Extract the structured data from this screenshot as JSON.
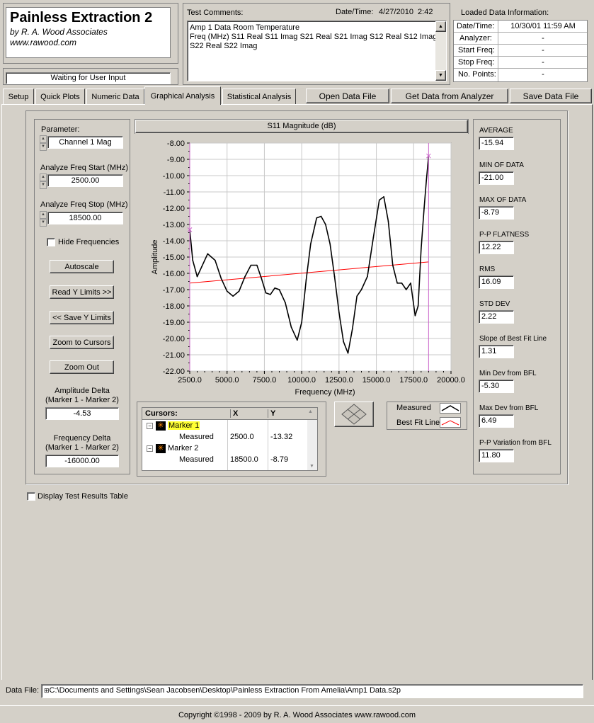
{
  "app": {
    "title": "Painless Extraction 2",
    "byline": "by R. A. Wood Associates",
    "website": "www.rawood.com",
    "status": "Waiting for User Input"
  },
  "comments": {
    "label": "Test Comments:",
    "datetime_label": "Date/Time:",
    "datetime_value": "4/27/2010  2:42",
    "lines": [
      "Amp 1 Data Room Temperature",
      "Freq (MHz) S11 Real S11 Imag S21 Real S21 Imag S12 Real S12 Imag",
      "S22 Real S22 Imag"
    ]
  },
  "loaded": {
    "header": "Loaded Data Information:",
    "rows": [
      {
        "label": "Date/Time:",
        "value": "10/30/01 11:59 AM"
      },
      {
        "label": "Analyzer:",
        "value": "-"
      },
      {
        "label": "Start Freq:",
        "value": "-"
      },
      {
        "label": "Stop Freq:",
        "value": "-"
      },
      {
        "label": "No. Points:",
        "value": "-"
      }
    ]
  },
  "tabs": [
    "Setup",
    "Quick Plots",
    "Numeric Data",
    "Graphical Analysis",
    "Statistical Analysis"
  ],
  "actions": {
    "open": "Open Data File",
    "get": "Get Data from Analyzer",
    "save": "Save Data File"
  },
  "left": {
    "parameter_label": "Parameter:",
    "parameter_value": "Channel 1 Mag",
    "start_label": "Analyze Freq Start (MHz)",
    "start_value": "2500.00",
    "stop_label": "Analyze Freq Stop (MHz)",
    "stop_value": "18500.00",
    "hide_freq": "Hide Frequencies",
    "autoscale": "Autoscale",
    "read_y": "Read Y Limits >>",
    "save_y": "<< Save Y Limits",
    "zoom_cursors": "Zoom to Cursors",
    "zoom_out": "Zoom Out",
    "amp_delta_label1": "Amplitude Delta",
    "amp_delta_label2": "(Marker 1 - Marker 2)",
    "amp_delta_value": "-4.53",
    "freq_delta_label1": "Frequency Delta",
    "freq_delta_label2": "(Marker 1 - Marker 2)",
    "freq_delta_value": "-16000.00"
  },
  "cursors": {
    "header": "Cursors:",
    "col_x": "X",
    "col_y": "Y",
    "markers": [
      {
        "name": "Marker 1",
        "sub": "Measured",
        "x": "2500.0",
        "y": "-13.32"
      },
      {
        "name": "Marker 2",
        "sub": "Measured",
        "x": "18500.0",
        "y": "-8.79"
      }
    ]
  },
  "legend": {
    "measured": "Measured",
    "bfl": "Best Fit Line"
  },
  "stats": [
    {
      "label": "AVERAGE",
      "value": "-15.94"
    },
    {
      "label": "MIN OF DATA",
      "value": "-21.00"
    },
    {
      "label": "MAX OF DATA",
      "value": "-8.79"
    },
    {
      "label": "P-P FLATNESS",
      "value": "12.22"
    },
    {
      "label": "RMS",
      "value": "16.09"
    },
    {
      "label": "STD DEV",
      "value": "2.22"
    },
    {
      "label": "Slope of Best Fit Line",
      "value": "1.31"
    },
    {
      "label": "Min Dev from BFL",
      "value": "-5.30"
    },
    {
      "label": "Max Dev from BFL",
      "value": "6.49"
    },
    {
      "label": "P-P Variation from BFL",
      "value": "11.80"
    }
  ],
  "display_table": "Display Test Results Table",
  "datafile": {
    "label": "Data File:",
    "path": "C:\\Documents and Settings\\Sean Jacobsen\\Desktop\\Painless Extraction From Amelia\\Amp1 Data.s2p"
  },
  "copyright": "Copyright ©1998 - 2009 by R. A. Wood Associates www.rawood.com",
  "colors": {
    "bfl": "#ff0000",
    "cursor": "#cc66cc",
    "measured": "#000000"
  },
  "chart_data": {
    "type": "line",
    "title": "S11 Magnitude (dB)",
    "xlabel": "Frequency (MHz)",
    "ylabel": "Amplitude",
    "xlim": [
      2500,
      20000
    ],
    "ylim": [
      -22,
      -8
    ],
    "x_ticks": [
      "2500.0",
      "5000.0",
      "7500.0",
      "10000.0",
      "12500.0",
      "15000.0",
      "17500.0",
      "20000.0"
    ],
    "y_ticks": [
      "-8.00",
      "-9.00",
      "-10.00",
      "-11.00",
      "-12.00",
      "-13.00",
      "-14.00",
      "-15.00",
      "-16.00",
      "-17.00",
      "-18.00",
      "-19.00",
      "-20.00",
      "-21.00",
      "-22.00"
    ],
    "grid": true,
    "series": [
      {
        "name": "Measured",
        "x": [
          2500,
          2700,
          3000,
          3300,
          3700,
          4200,
          4600,
          5000,
          5400,
          5800,
          6200,
          6600,
          7000,
          7300,
          7600,
          7900,
          8200,
          8500,
          8900,
          9300,
          9700,
          10000,
          10300,
          10600,
          11000,
          11300,
          11600,
          11900,
          12200,
          12500,
          12800,
          13100,
          13400,
          13700,
          14000,
          14400,
          14800,
          15200,
          15500,
          15800,
          16100,
          16400,
          16700,
          17000,
          17300,
          17600,
          17800,
          18000,
          18200,
          18350,
          18500
        ],
        "y": [
          -13.3,
          -15.2,
          -16.2,
          -15.6,
          -14.8,
          -15.2,
          -16.3,
          -17.1,
          -17.4,
          -17.1,
          -16.2,
          -15.5,
          -15.5,
          -16.3,
          -17.2,
          -17.3,
          -16.9,
          -17.0,
          -17.8,
          -19.3,
          -20.1,
          -19.0,
          -16.4,
          -14.2,
          -12.6,
          -12.5,
          -13.0,
          -14.2,
          -16.2,
          -18.4,
          -20.2,
          -20.9,
          -19.4,
          -17.4,
          -17.0,
          -16.2,
          -13.8,
          -11.5,
          -11.3,
          -12.8,
          -15.5,
          -16.6,
          -16.6,
          -17.0,
          -16.6,
          -18.6,
          -18.0,
          -14.5,
          -12.0,
          -10.3,
          -8.8
        ]
      },
      {
        "name": "Best Fit Line",
        "x": [
          2500,
          18500
        ],
        "y": [
          -16.6,
          -15.3
        ]
      }
    ],
    "cursors": [
      {
        "name": "Marker 1",
        "x": 2500,
        "y": -13.32
      },
      {
        "name": "Marker 2",
        "x": 18500,
        "y": -8.79
      }
    ]
  }
}
